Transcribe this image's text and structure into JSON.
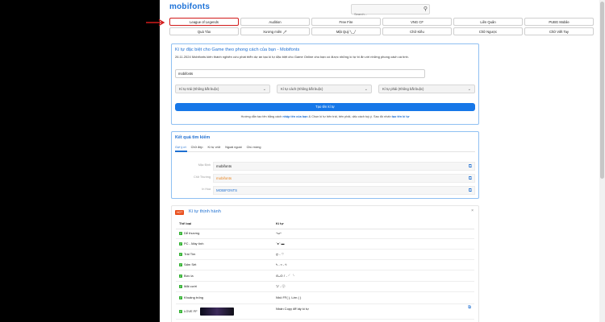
{
  "header": {
    "logo": "mobifonts",
    "search_placeholder": "Search..."
  },
  "game_buttons": {
    "row1": [
      "League of Legends",
      "Audition",
      "Free Fire",
      "VNG CF",
      "Liên Quân",
      "PUBG Mobile"
    ],
    "row2": [
      "Quá Tảo",
      "Xương miên 🗡",
      "Mật Quý ╲_╱",
      "Chữ Kiều",
      "Chữ Ngược",
      "Chữ Viết Tay"
    ],
    "active": "League of Legends"
  },
  "generator": {
    "title": "Kí tự đặc biệt cho Game theo phong cách của bạn - Mobifonts",
    "description": "26.11.2024 Mobifonts kiến thành nghiên cứu phát triển dự án tạo kí tự đặc biệt cho Game Online cho bạn có được những kí tự bí ẩn với những phong cách cá tính.",
    "input_value": "mobifonts",
    "select_left": "Kí tự trái (Không bắt buộc)",
    "select_middle": "Kí tự cách (Không bắt buộc)",
    "select_right": "Kí tự phải (Không bắt buộc)",
    "button_label": "Tạo tên kí tự",
    "guide_prefix": "Hướng dẫn tạo tên bằng cách",
    "guide_link1": "nhập tên của bạn",
    "guide_middle": "& Chọn kí tự bên trái, bên phải, dấu cách tuỳ ý. Sau đó nhấn",
    "guide_link2": "tạo tên kí tự"
  },
  "results": {
    "title": "Kết quả tìm kiếm",
    "tabs": [
      "Gợi ý ơi",
      "Chữ đẹp",
      "Kí tự chữ",
      "Ngoài ngoài",
      "Chú mừng"
    ],
    "rows": [
      {
        "label": "Mặc Định",
        "value": "mobifonts"
      },
      {
        "label": "Chữ Thường",
        "value": "mobifonts"
      },
      {
        "label": "In Hoa",
        "value": "MOBIFONTS"
      }
    ],
    "colors": {
      "row2": "#e8801a",
      "row3": "#1e6fd1"
    }
  },
  "trending": {
    "badge": "HOT",
    "title": "Kí tự thịnh hành",
    "close": "×",
    "col_category": "Thể loại",
    "col_char": "Kí tự",
    "rows": [
      {
        "category": "Dễ thương",
        "chars": "^ω^"
      },
      {
        "category": "PC - Máy tính",
        "chars": "ᵔᴥᵔ ▬"
      },
      {
        "category": "Trái Tim",
        "chars": "ღ - ♡"
      },
      {
        "category": "Sấm Sét",
        "chars": "ϟ - ≈ - ϟ"
      },
      {
        "category": "Bức la",
        "chars": "ʘᴗʘ ﾉ - ╯╰"
      },
      {
        "category": "Mặt cười",
        "chars": "ツ - ㋡"
      },
      {
        "category": "Khoảng trống",
        "chars": "Nhô FF( ), Lớn ( )"
      },
      {
        "category": "LOVE FF",
        "chars": "Nhấn Copy để lấy kí tự"
      }
    ]
  }
}
